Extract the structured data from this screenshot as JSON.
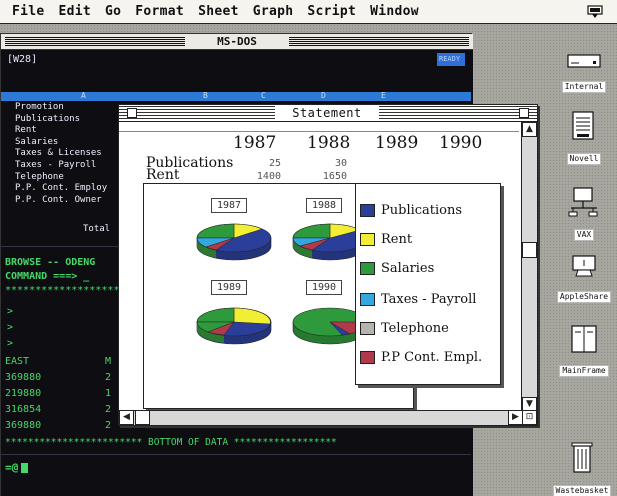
{
  "menubar": {
    "items": [
      "File",
      "Edit",
      "Go",
      "Format",
      "Sheet",
      "Graph",
      "Script",
      "Window"
    ]
  },
  "dos_window": {
    "title": "MS-DOS",
    "cell_ref": "[W28]",
    "readout": "READY",
    "column_letters": [
      "A",
      "B",
      "C",
      "D",
      "E"
    ],
    "rows": [
      "Promotion",
      "Publications",
      "Rent",
      "Salaries",
      "Taxes & Licenses",
      "Taxes - Payroll",
      "Telephone",
      "P.P. Cont. Employ",
      "P.P. Cont. Owner"
    ],
    "total_label": "Total",
    "browse_line": "BROWSE -- ODENG",
    "command_line": "COMMAND ===> _",
    "stars_line": "**********************",
    "prompts": [
      ">",
      ">",
      ">"
    ],
    "region_header": "EAST",
    "col_header_m": "M",
    "data_rows": [
      {
        "a": "369880",
        "b": "2"
      },
      {
        "a": "219880",
        "b": "1"
      },
      {
        "a": "316854",
        "b": "2"
      },
      {
        "a": "369880",
        "b": "2"
      }
    ],
    "bottom_line": "************************ BOTTOM OF DATA ******************",
    "bottom_prompt": "=@"
  },
  "statement": {
    "title": "Statement",
    "years": [
      "1987",
      "1988",
      "1989",
      "1990"
    ],
    "rows": [
      {
        "label": "Publications",
        "v1987": "25",
        "v1988": "30"
      },
      {
        "label": "Rent",
        "v1987": "1400",
        "v1988": "1650"
      }
    ],
    "pie_labels": [
      "1987",
      "1988",
      "1989",
      "1990"
    ],
    "legend": [
      {
        "label": "Publications",
        "color": "#2b3f9a"
      },
      {
        "label": "Rent",
        "color": "#f2ee34"
      },
      {
        "label": "Salaries",
        "color": "#2f9a3c"
      },
      {
        "label": "Taxes - Payroll",
        "color": "#33a8e0"
      },
      {
        "label": "Telephone",
        "color": "#b5b5b0"
      },
      {
        "label": "P.P Cont. Empl.",
        "color": "#b0394a"
      }
    ]
  },
  "desktop_icons": [
    {
      "label": "Internal",
      "icon": "hard-disk-icon"
    },
    {
      "label": "Novell",
      "icon": "server-icon"
    },
    {
      "label": "VAX",
      "icon": "network-icon"
    },
    {
      "label": "AppleShare",
      "icon": "appleshare-icon"
    },
    {
      "label": "MainFrame",
      "icon": "mainframe-icon"
    },
    {
      "label": "Wastebasket",
      "icon": "trash-icon"
    }
  ]
}
